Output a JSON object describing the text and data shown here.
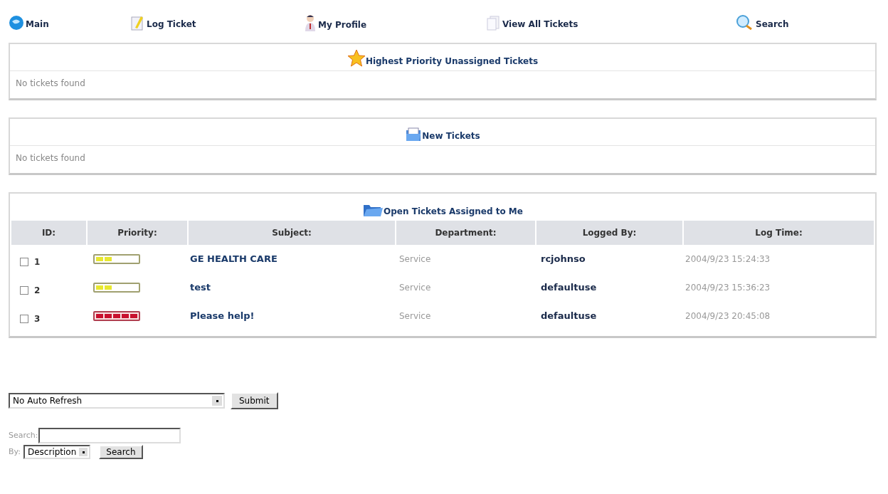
{
  "nav": [
    {
      "label": "Main"
    },
    {
      "label": "Log Ticket"
    },
    {
      "label": "My Profile"
    },
    {
      "label": "View All Tickets"
    },
    {
      "label": "Search"
    }
  ],
  "sections": [
    {
      "title": "Highest Priority Unassigned Tickets",
      "empty_text": "No tickets found"
    },
    {
      "title": "New Tickets",
      "empty_text": "No tickets found"
    }
  ],
  "assigned": {
    "title": "Open Tickets Assigned to Me",
    "columns": [
      "ID:",
      "Priority:",
      "Subject:",
      "Department:",
      "Logged By:",
      "Log Time:"
    ],
    "rows": [
      {
        "checked": false,
        "id": "1",
        "stars": 2,
        "color": "#e8e830",
        "subject": "GE HEALTH CARE",
        "department": "Service",
        "logged_by": "rcjohnso",
        "log_time": "2004/9/23 15:24:33"
      },
      {
        "checked": false,
        "id": "2",
        "stars": 2,
        "color": "#e8e830",
        "subject": "test",
        "department": "Service",
        "logged_by": "defaultuse",
        "log_time": "2004/9/23 15:36:23"
      },
      {
        "checked": false,
        "id": "3",
        "stars": 5,
        "color": "#c8102e",
        "subject": "Please help!",
        "department": "Service",
        "logged_by": "defaultuse",
        "log_time": "2004/9/23 20:45:08"
      }
    ]
  },
  "refresh": {
    "value": "No Auto Refresh",
    "button": "Submit"
  },
  "search": {
    "label": "Search:",
    "by_label": "By:",
    "by_value": "Description",
    "button": "Search"
  }
}
